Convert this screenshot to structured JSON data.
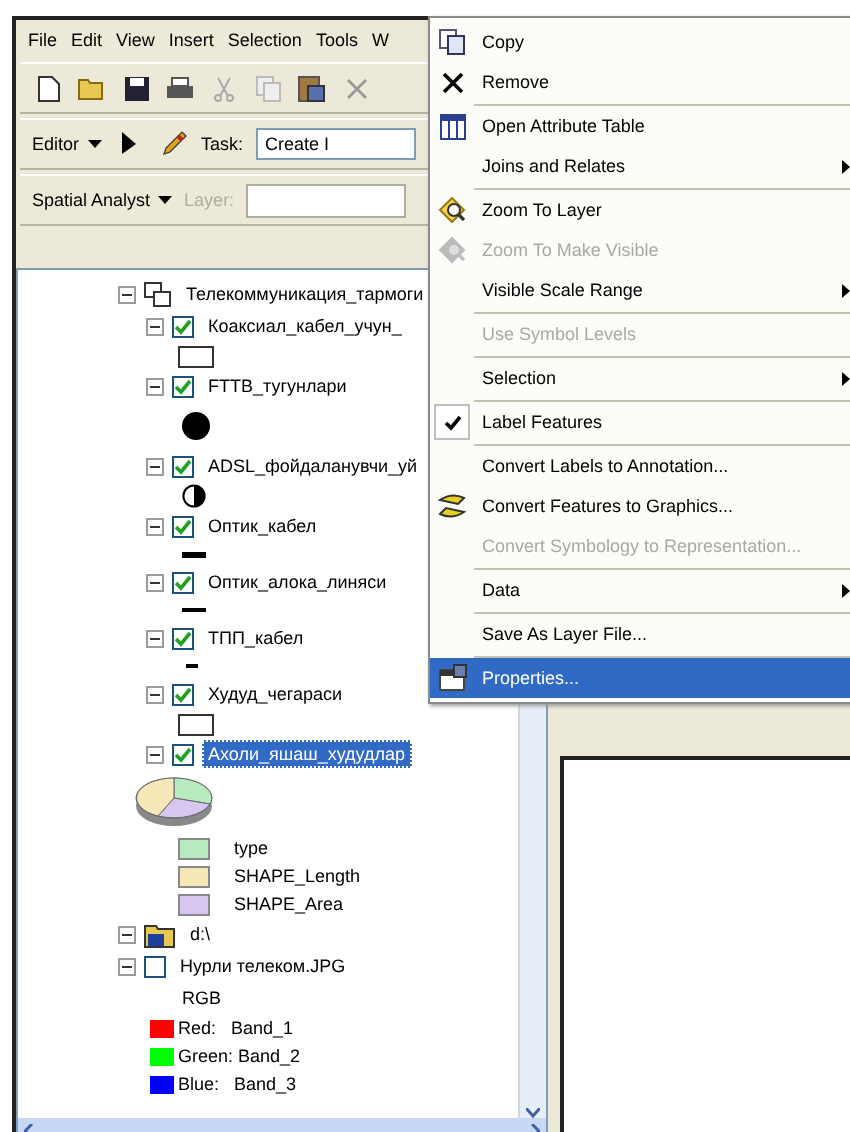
{
  "menu_bar": [
    "File",
    "Edit",
    "View",
    "Insert",
    "Selection",
    "Tools",
    "W"
  ],
  "editor_toolbar": {
    "editor": "Editor",
    "task_label": "Task:",
    "task_value": "Create I"
  },
  "analyst_toolbar": {
    "spatial_analyst": "Spatial Analyst",
    "layer_label": "Layer:"
  },
  "toc": {
    "group": {
      "name": "Телекоммуникация_тармоги",
      "expanded": true,
      "layers": [
        {
          "name": "Коаксиал_кабел_учун_",
          "checked": true,
          "selected": false,
          "kind": "rect"
        },
        {
          "name": "FTTB_тугунлари",
          "checked": true,
          "selected": false,
          "kind": "dot"
        },
        {
          "name": "ADSL_фойдаланувчи_уй",
          "checked": true,
          "selected": false,
          "kind": "half"
        },
        {
          "name": "Оптик_кабел",
          "checked": true,
          "selected": false,
          "kind": "thick"
        },
        {
          "name": "Оптик_алока_линяси",
          "checked": true,
          "selected": false,
          "kind": "line"
        },
        {
          "name": "ТПП_кабел",
          "checked": true,
          "selected": false,
          "kind": "short"
        },
        {
          "name": "Худуд_чегараси",
          "checked": true,
          "selected": false,
          "kind": "rect"
        },
        {
          "name": "Ахоли_яшаш_худудлар",
          "checked": true,
          "selected": true,
          "kind": "pie",
          "legend": [
            {
              "label": "type",
              "color": "#b8ecc0"
            },
            {
              "label": "SHAPE_Length",
              "color": "#f6e8b8"
            },
            {
              "label": "SHAPE_Area",
              "color": "#d6c6f0"
            }
          ]
        }
      ]
    },
    "folder": {
      "name": "d:\\",
      "layer": {
        "name": "Нурли телеком.JPG",
        "checked": false,
        "band_title": "RGB",
        "bands": [
          {
            "label": "Red:   Band_1",
            "color": "#ff0000"
          },
          {
            "label": "Green: Band_2",
            "color": "#00ff00"
          },
          {
            "label": "Blue:   Band_3",
            "color": "#0000ff"
          }
        ]
      }
    }
  },
  "context_menu": [
    {
      "label": "Copy",
      "kind": "copy",
      "disabled": false,
      "submenu": false,
      "checked": false,
      "selected": false,
      "sep_after": false
    },
    {
      "label": "Remove",
      "kind": "remove",
      "disabled": false,
      "submenu": false,
      "checked": false,
      "selected": false,
      "sep_after": true
    },
    {
      "label": "Open Attribute Table",
      "kind": "table",
      "disabled": false,
      "submenu": false,
      "checked": false,
      "selected": false,
      "sep_after": false
    },
    {
      "label": "Joins and Relates",
      "kind": "plain",
      "disabled": false,
      "submenu": true,
      "checked": false,
      "selected": false,
      "sep_after": true
    },
    {
      "label": "Zoom To Layer",
      "kind": "zoom",
      "disabled": false,
      "submenu": false,
      "checked": false,
      "selected": false,
      "sep_after": false
    },
    {
      "label": "Zoom To Make Visible",
      "kind": "zoom",
      "disabled": true,
      "submenu": false,
      "checked": false,
      "selected": false,
      "sep_after": false
    },
    {
      "label": "Visible Scale Range",
      "kind": "plain",
      "disabled": false,
      "submenu": true,
      "checked": false,
      "selected": false,
      "sep_after": true
    },
    {
      "label": "Use Symbol Levels",
      "kind": "plain",
      "disabled": true,
      "submenu": false,
      "checked": false,
      "selected": false,
      "sep_after": true
    },
    {
      "label": "Selection",
      "kind": "plain",
      "disabled": false,
      "submenu": true,
      "checked": false,
      "selected": false,
      "sep_after": true
    },
    {
      "label": "Label Features",
      "kind": "plain",
      "disabled": false,
      "submenu": false,
      "checked": true,
      "selected": false,
      "sep_after": true
    },
    {
      "label": "Convert Labels to Annotation...",
      "kind": "plain",
      "disabled": false,
      "submenu": false,
      "checked": false,
      "selected": false,
      "sep_after": false
    },
    {
      "label": "Convert Features to Graphics...",
      "kind": "convert",
      "disabled": false,
      "submenu": false,
      "checked": false,
      "selected": false,
      "sep_after": false
    },
    {
      "label": "Convert Symbology to Representation...",
      "kind": "plain",
      "disabled": true,
      "submenu": false,
      "checked": false,
      "selected": false,
      "sep_after": true
    },
    {
      "label": "Data",
      "kind": "plain",
      "disabled": false,
      "submenu": true,
      "checked": false,
      "selected": false,
      "sep_after": true
    },
    {
      "label": "Save As Layer File...",
      "kind": "plain",
      "disabled": false,
      "submenu": false,
      "checked": false,
      "selected": false,
      "sep_after": true
    },
    {
      "label": "Properties...",
      "kind": "props",
      "disabled": false,
      "submenu": false,
      "checked": false,
      "selected": true,
      "sep_after": false
    }
  ]
}
